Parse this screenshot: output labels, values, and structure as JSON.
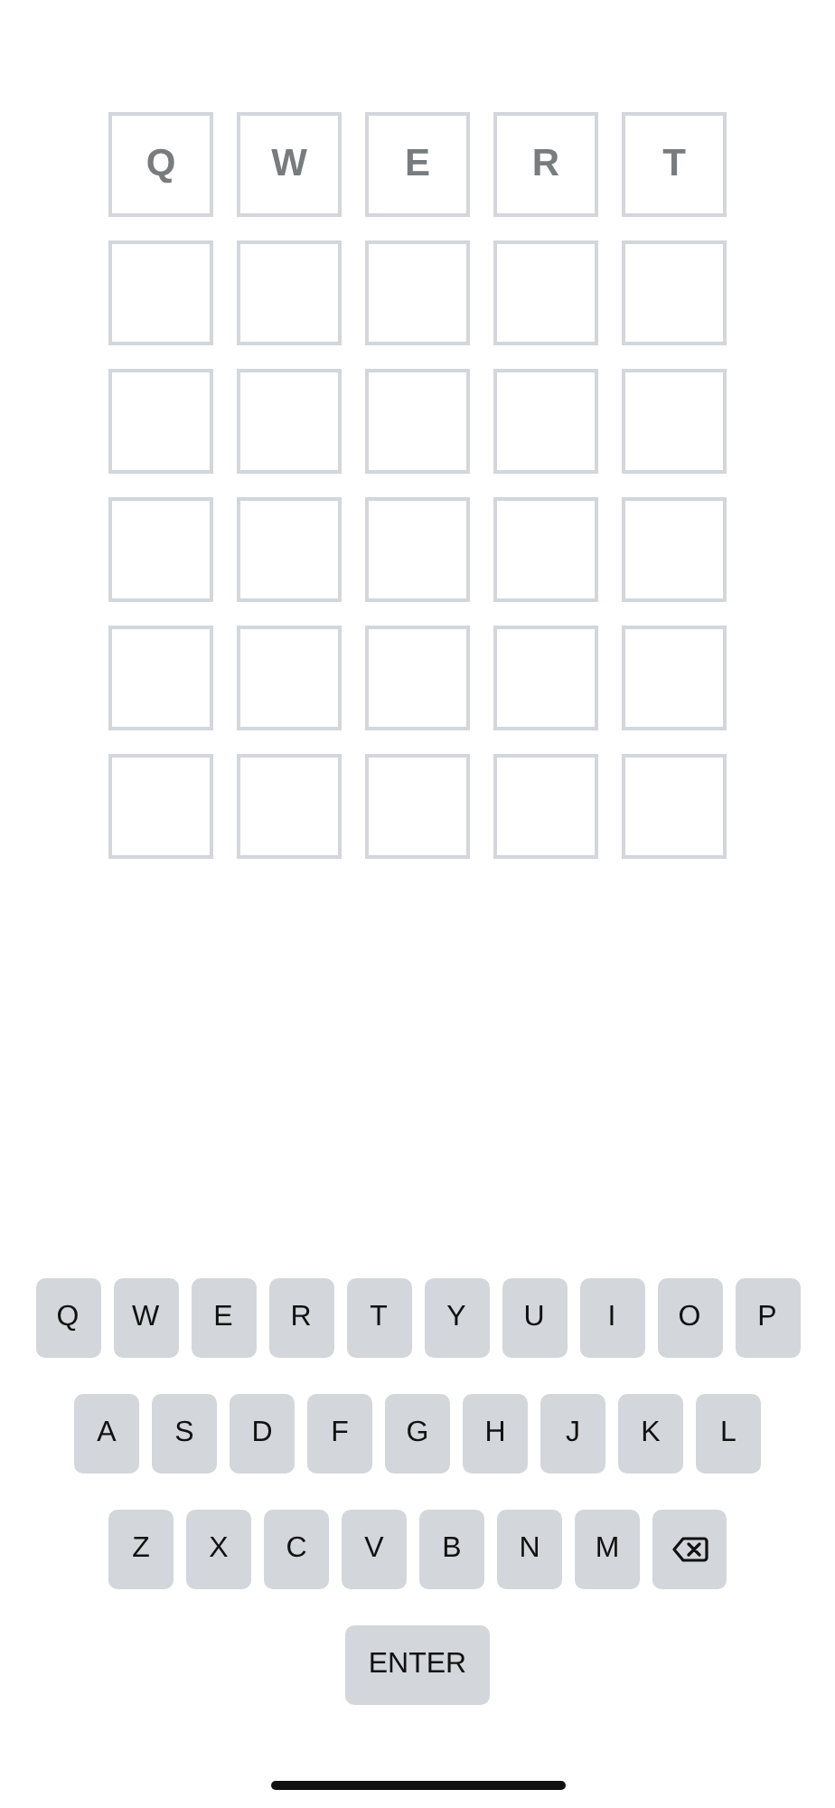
{
  "board": {
    "rows": [
      {
        "kind": "typed",
        "letters": [
          "Q",
          "W",
          "E",
          "R",
          "T"
        ]
      },
      {
        "kind": "blank"
      },
      {
        "kind": "blank"
      },
      {
        "kind": "blank"
      },
      {
        "kind": "blank"
      },
      {
        "kind": "blank"
      }
    ]
  },
  "keyboard": {
    "rows": [
      {
        "keys": [
          {
            "kind": "letter",
            "label": "Q"
          },
          {
            "kind": "letter",
            "label": "W"
          },
          {
            "kind": "letter",
            "label": "E"
          },
          {
            "kind": "letter",
            "label": "R"
          },
          {
            "kind": "letter",
            "label": "T"
          },
          {
            "kind": "letter",
            "label": "Y"
          },
          {
            "kind": "letter",
            "label": "U"
          },
          {
            "kind": "letter",
            "label": "I"
          },
          {
            "kind": "letter",
            "label": "O"
          },
          {
            "kind": "letter",
            "label": "P"
          }
        ]
      },
      {
        "keys": [
          {
            "kind": "letter",
            "label": "A"
          },
          {
            "kind": "letter",
            "label": "S"
          },
          {
            "kind": "letter",
            "label": "D"
          },
          {
            "kind": "letter",
            "label": "F"
          },
          {
            "kind": "letter",
            "label": "G"
          },
          {
            "kind": "letter",
            "label": "H"
          },
          {
            "kind": "letter",
            "label": "J"
          },
          {
            "kind": "letter",
            "label": "K"
          },
          {
            "kind": "letter",
            "label": "L"
          }
        ]
      },
      {
        "keys": [
          {
            "kind": "letter",
            "label": "Z"
          },
          {
            "kind": "letter",
            "label": "X"
          },
          {
            "kind": "letter",
            "label": "C"
          },
          {
            "kind": "letter",
            "label": "V"
          },
          {
            "kind": "letter",
            "label": "B"
          },
          {
            "kind": "letter",
            "label": "N"
          },
          {
            "kind": "letter",
            "label": "M"
          },
          {
            "kind": "backspace"
          }
        ]
      }
    ],
    "enter_key": {
      "label": "ENTER"
    }
  }
}
